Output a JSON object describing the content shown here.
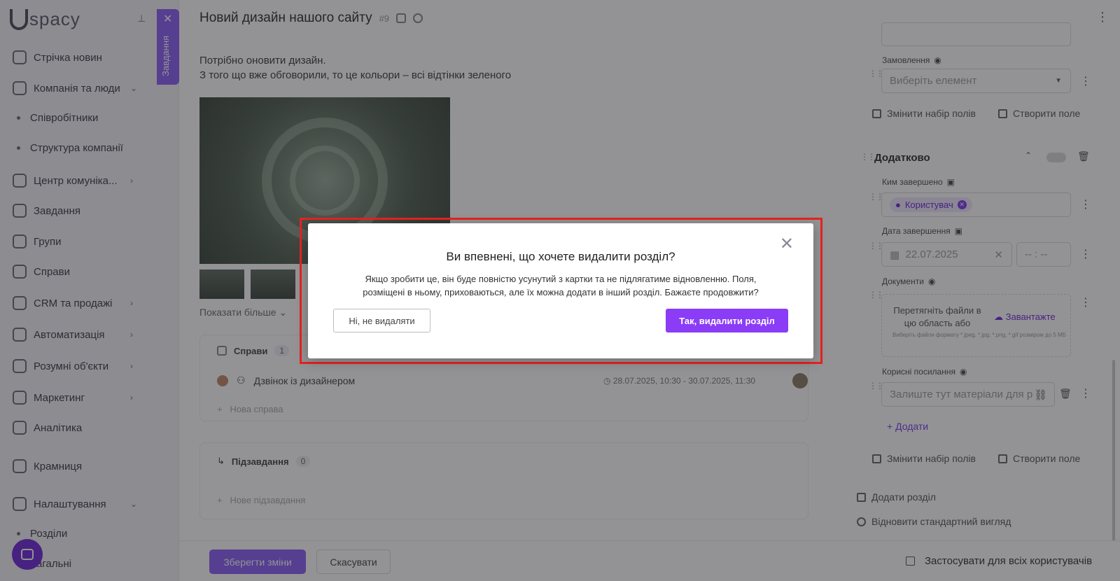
{
  "sidebar": {
    "brand": "spacy",
    "vertical_tab": "Завдання",
    "items": [
      {
        "label": "Стрічка новин"
      },
      {
        "label": "Компанія та люди"
      },
      {
        "label": "Співробітники"
      },
      {
        "label": "Структура компанії"
      },
      {
        "label": "Центр комуніка..."
      },
      {
        "label": "Завдання"
      },
      {
        "label": "Групи"
      },
      {
        "label": "Справи"
      },
      {
        "label": "CRM та продажі"
      },
      {
        "label": "Автоматизація"
      },
      {
        "label": "Розумні об'єкти"
      },
      {
        "label": "Маркетинг"
      },
      {
        "label": "Аналітика"
      },
      {
        "label": "Крамниця"
      },
      {
        "label": "Налаштування"
      },
      {
        "label": "Розділи"
      },
      {
        "label": "Загальні"
      }
    ]
  },
  "header": {
    "title": "Новий дизайн нашого сайту",
    "task_no": "#9"
  },
  "main": {
    "description": [
      "Потрібно оновити дизайн.",
      "З того що вже обговорили, то це кольори – всі відтінки зеленого"
    ],
    "show_more": "Показати більше",
    "tasks": {
      "title": "Справи",
      "count": "1",
      "item": "Дзвінок із дизайнером",
      "time": "28.07.2025, 10:30 - 30.07.2025, 11:30",
      "add": "Нова справа"
    },
    "subtasks": {
      "title": "Підзавдання",
      "count": "0",
      "add": "Нове підзавдання"
    }
  },
  "footer": {
    "save": "Зберегти зміни",
    "cancel": "Скасувати",
    "apply_all": "Застосувати для всіх користувачів"
  },
  "right_panel": {
    "orders_label": "Замовлення",
    "orders_placeholder": "Виберіть елемент",
    "change_fields": "Змінити набір полів",
    "create_field": "Створити поле",
    "section_title": "Додатково",
    "completed_by_label": "Ким завершено",
    "completed_by_value": "Користувач",
    "completed_date_label": "Дата завершення",
    "completed_date": "22.07.2025",
    "completed_time": "-- : --",
    "documents_label": "Документи",
    "drop_text": "Перетягніть файли в цю область або",
    "upload": "Завантажте",
    "drop_small": "Виберіть файли формату *.jpeg, *.jpg, *.png, *.gif розміром до 5 МБ",
    "links_label": "Корисні посилання",
    "links_placeholder": "Залиште тут матеріали для р",
    "add": "Додати",
    "change_fields_2": "Змінити набір полів",
    "create_field_2": "Створити поле",
    "add_section": "Додати розділ",
    "restore_default": "Відновити стандартний вигляд"
  },
  "modal": {
    "title": "Ви впевнені, що хочете видалити розділ?",
    "text_line1": "Якщо зробити це, він буде повністю усунутий з картки та не підлягатиме відновленню. Поля,",
    "text_line2": "розміщені в ньому, приховаються, але їх можна додати в інший розділ. Бажаєте продовжити?",
    "cancel": "Ні, не видаляти",
    "confirm": "Так, видалити розділ",
    "close_icon": "close-icon",
    "accent_color": "#8b3cf7",
    "highlight_color": "#e8231f"
  }
}
